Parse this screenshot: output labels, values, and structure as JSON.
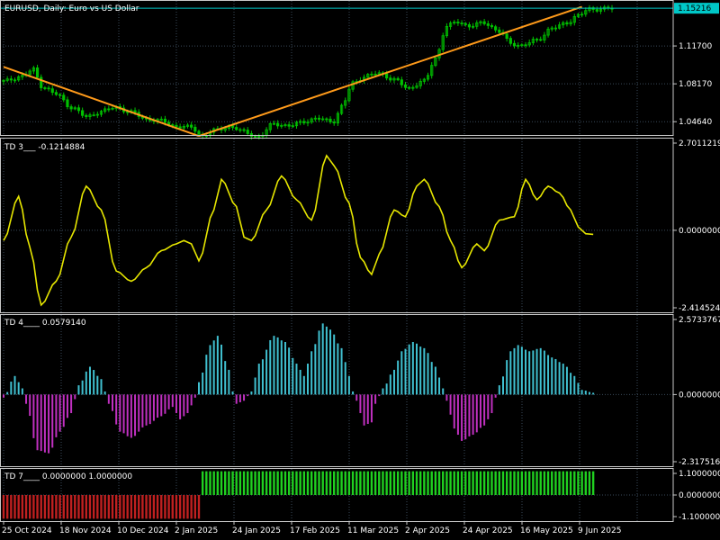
{
  "colors": {
    "background": "#000000",
    "grid": "#3a4a5a",
    "border": "#c8c8c8",
    "text": "#ffffff",
    "candle": "#00c000",
    "trendline": "#ff9a1a",
    "price_line": "#00c8c8",
    "price_badge": "#00c8c8",
    "td3_line": "#e6e600",
    "td4_positive": "#40c0d0",
    "td4_negative": "#c030c0",
    "td7_up": "#20d020",
    "td7_down": "#c02020"
  },
  "chart_data": [
    {
      "type": "candlestick",
      "title": "EURUSD, Daily:  Euro vs US Dollar",
      "symbol": "EURUSD",
      "timeframe": "Daily",
      "description": "Euro vs US Dollar",
      "x_ticks": [
        "25 Oct 2024",
        "18 Nov 2024",
        "10 Dec 2024",
        "2 Jan 2025",
        "24 Jan 2025",
        "17 Feb 2025",
        "11 Mar 2025",
        "2 Apr 2025",
        "24 Apr 2025",
        "16 May 2025",
        "9 Jun 2025"
      ],
      "y_ticks": [
        "1.11700",
        "1.08170",
        "1.04640"
      ],
      "ylim": [
        1.034,
        1.159
      ],
      "current_price": "1.15216",
      "close_anchors": [
        {
          "i": 0,
          "v": 1.084
        },
        {
          "i": 5,
          "v": 1.089
        },
        {
          "i": 8,
          "v": 1.095
        },
        {
          "i": 10,
          "v": 1.08
        },
        {
          "i": 14,
          "v": 1.072
        },
        {
          "i": 18,
          "v": 1.06
        },
        {
          "i": 22,
          "v": 1.051
        },
        {
          "i": 26,
          "v": 1.056
        },
        {
          "i": 30,
          "v": 1.06
        },
        {
          "i": 34,
          "v": 1.055
        },
        {
          "i": 38,
          "v": 1.049
        },
        {
          "i": 42,
          "v": 1.047
        },
        {
          "i": 46,
          "v": 1.042
        },
        {
          "i": 50,
          "v": 1.041
        },
        {
          "i": 53,
          "v": 1.033
        },
        {
          "i": 56,
          "v": 1.038
        },
        {
          "i": 60,
          "v": 1.042
        },
        {
          "i": 64,
          "v": 1.037
        },
        {
          "i": 68,
          "v": 1.032
        },
        {
          "i": 72,
          "v": 1.045
        },
        {
          "i": 76,
          "v": 1.042
        },
        {
          "i": 80,
          "v": 1.047
        },
        {
          "i": 84,
          "v": 1.049
        },
        {
          "i": 88,
          "v": 1.047
        },
        {
          "i": 90,
          "v": 1.06
        },
        {
          "i": 93,
          "v": 1.083
        },
        {
          "i": 96,
          "v": 1.088
        },
        {
          "i": 100,
          "v": 1.092
        },
        {
          "i": 104,
          "v": 1.085
        },
        {
          "i": 108,
          "v": 1.078
        },
        {
          "i": 112,
          "v": 1.084
        },
        {
          "i": 115,
          "v": 1.106
        },
        {
          "i": 118,
          "v": 1.135
        },
        {
          "i": 121,
          "v": 1.14
        },
        {
          "i": 124,
          "v": 1.135
        },
        {
          "i": 128,
          "v": 1.139
        },
        {
          "i": 132,
          "v": 1.13
        },
        {
          "i": 135,
          "v": 1.12
        },
        {
          "i": 138,
          "v": 1.117
        },
        {
          "i": 142,
          "v": 1.123
        },
        {
          "i": 146,
          "v": 1.133
        },
        {
          "i": 150,
          "v": 1.139
        },
        {
          "i": 153,
          "v": 1.145
        },
        {
          "i": 156,
          "v": 1.152
        },
        {
          "i": 159,
          "v": 1.151
        },
        {
          "i": 162,
          "v": 1.1521
        }
      ],
      "trendlines": [
        {
          "from": {
            "i": 0,
            "v": 1.0975
          },
          "to": {
            "i": 52,
            "v": 1.033
          }
        },
        {
          "from": {
            "i": 52,
            "v": 1.033
          },
          "to": {
            "i": 154,
            "v": 1.1535
          }
        }
      ]
    },
    {
      "type": "line",
      "title": "TD 3___  -0.1214884",
      "y_ticks": [
        "2.7011219",
        "0.0000000",
        "-2.4145245"
      ],
      "ylim": [
        -2.4145245,
        2.7011219
      ],
      "last_value": -0.1214884,
      "anchors": [
        {
          "i": 0,
          "v": -0.3
        },
        {
          "i": 4,
          "v": 1.0
        },
        {
          "i": 7,
          "v": -0.5
        },
        {
          "i": 10,
          "v": -2.2
        },
        {
          "i": 14,
          "v": -1.5
        },
        {
          "i": 18,
          "v": -0.2
        },
        {
          "i": 22,
          "v": 1.3
        },
        {
          "i": 26,
          "v": 0.6
        },
        {
          "i": 30,
          "v": -1.2
        },
        {
          "i": 34,
          "v": -1.5
        },
        {
          "i": 38,
          "v": -1.1
        },
        {
          "i": 42,
          "v": -0.6
        },
        {
          "i": 46,
          "v": -0.4
        },
        {
          "i": 48,
          "v": -0.3
        },
        {
          "i": 50,
          "v": -0.4
        },
        {
          "i": 52,
          "v": -0.9
        },
        {
          "i": 56,
          "v": 0.6
        },
        {
          "i": 58,
          "v": 1.5
        },
        {
          "i": 62,
          "v": 0.7
        },
        {
          "i": 64,
          "v": -0.2
        },
        {
          "i": 66,
          "v": -0.3
        },
        {
          "i": 70,
          "v": 0.6
        },
        {
          "i": 74,
          "v": 1.6
        },
        {
          "i": 78,
          "v": 0.9
        },
        {
          "i": 82,
          "v": 0.3
        },
        {
          "i": 86,
          "v": 2.2
        },
        {
          "i": 88,
          "v": 1.9
        },
        {
          "i": 92,
          "v": 0.8
        },
        {
          "i": 95,
          "v": -0.8
        },
        {
          "i": 98,
          "v": -1.3
        },
        {
          "i": 100,
          "v": -0.7
        },
        {
          "i": 104,
          "v": 0.6
        },
        {
          "i": 107,
          "v": 0.4
        },
        {
          "i": 110,
          "v": 1.3
        },
        {
          "i": 112,
          "v": 1.5
        },
        {
          "i": 116,
          "v": 0.7
        },
        {
          "i": 119,
          "v": -0.3
        },
        {
          "i": 122,
          "v": -1.1
        },
        {
          "i": 126,
          "v": -0.4
        },
        {
          "i": 128,
          "v": -0.6
        },
        {
          "i": 132,
          "v": 0.3
        },
        {
          "i": 136,
          "v": 0.4
        },
        {
          "i": 139,
          "v": 1.5
        },
        {
          "i": 142,
          "v": 0.9
        },
        {
          "i": 145,
          "v": 1.3
        },
        {
          "i": 148,
          "v": 1.1
        },
        {
          "i": 151,
          "v": 0.6
        },
        {
          "i": 153,
          "v": 0.1
        },
        {
          "i": 155,
          "v": -0.1
        },
        {
          "i": 157,
          "v": -0.12
        }
      ]
    },
    {
      "type": "bar",
      "title": "TD 4____  0.0579140",
      "y_ticks": [
        "2.5733767",
        "0.0000000",
        "-2.3175166"
      ],
      "ylim": [
        -2.3175166,
        2.5733767
      ],
      "last_value": 0.057914,
      "anchors": [
        {
          "i": 0,
          "v": -0.1
        },
        {
          "i": 3,
          "v": 0.6
        },
        {
          "i": 5,
          "v": 0.2
        },
        {
          "i": 6,
          "v": -0.3
        },
        {
          "i": 9,
          "v": -1.8
        },
        {
          "i": 12,
          "v": -1.9
        },
        {
          "i": 15,
          "v": -1.2
        },
        {
          "i": 18,
          "v": -0.6
        },
        {
          "i": 20,
          "v": 0.3
        },
        {
          "i": 23,
          "v": 0.9
        },
        {
          "i": 26,
          "v": 0.5
        },
        {
          "i": 27,
          "v": 0.1
        },
        {
          "i": 28,
          "v": -0.3
        },
        {
          "i": 31,
          "v": -1.2
        },
        {
          "i": 34,
          "v": -1.4
        },
        {
          "i": 38,
          "v": -1.0
        },
        {
          "i": 42,
          "v": -0.7
        },
        {
          "i": 45,
          "v": -0.4
        },
        {
          "i": 47,
          "v": -0.8
        },
        {
          "i": 49,
          "v": -0.6
        },
        {
          "i": 51,
          "v": -0.1
        },
        {
          "i": 52,
          "v": 0.4
        },
        {
          "i": 55,
          "v": 1.6
        },
        {
          "i": 57,
          "v": 1.9
        },
        {
          "i": 60,
          "v": 0.8
        },
        {
          "i": 61,
          "v": 0.1
        },
        {
          "i": 62,
          "v": -0.3
        },
        {
          "i": 64,
          "v": -0.2
        },
        {
          "i": 66,
          "v": 0.1
        },
        {
          "i": 68,
          "v": 1.0
        },
        {
          "i": 72,
          "v": 1.9
        },
        {
          "i": 75,
          "v": 1.7
        },
        {
          "i": 78,
          "v": 1.0
        },
        {
          "i": 80,
          "v": 0.6
        },
        {
          "i": 82,
          "v": 1.4
        },
        {
          "i": 85,
          "v": 2.3
        },
        {
          "i": 87,
          "v": 2.1
        },
        {
          "i": 90,
          "v": 1.5
        },
        {
          "i": 92,
          "v": 0.6
        },
        {
          "i": 93,
          "v": 0.1
        },
        {
          "i": 94,
          "v": -0.2
        },
        {
          "i": 96,
          "v": -1.0
        },
        {
          "i": 98,
          "v": -0.9
        },
        {
          "i": 99,
          "v": -0.3
        },
        {
          "i": 101,
          "v": 0.2
        },
        {
          "i": 104,
          "v": 0.8
        },
        {
          "i": 106,
          "v": 1.4
        },
        {
          "i": 109,
          "v": 1.7
        },
        {
          "i": 112,
          "v": 1.5
        },
        {
          "i": 115,
          "v": 0.9
        },
        {
          "i": 117,
          "v": 0.2
        },
        {
          "i": 118,
          "v": -0.2
        },
        {
          "i": 120,
          "v": -1.1
        },
        {
          "i": 122,
          "v": -1.5
        },
        {
          "i": 125,
          "v": -1.3
        },
        {
          "i": 128,
          "v": -1.0
        },
        {
          "i": 130,
          "v": -0.6
        },
        {
          "i": 131,
          "v": -0.1
        },
        {
          "i": 132,
          "v": 0.3
        },
        {
          "i": 135,
          "v": 1.4
        },
        {
          "i": 137,
          "v": 1.6
        },
        {
          "i": 140,
          "v": 1.4
        },
        {
          "i": 143,
          "v": 1.5
        },
        {
          "i": 146,
          "v": 1.2
        },
        {
          "i": 149,
          "v": 1.0
        },
        {
          "i": 152,
          "v": 0.6
        },
        {
          "i": 154,
          "v": 0.15
        },
        {
          "i": 157,
          "v": 0.058
        }
      ]
    },
    {
      "type": "bar",
      "title": "TD 7____  0.0000000  1.0000000",
      "y_ticks": [
        "1.1000000",
        "0.0000000",
        "-1.1000000"
      ],
      "ylim": [
        -1.1,
        1.1
      ],
      "down_value": -1.0,
      "up_value": 1.0,
      "switch_index": 53
    }
  ]
}
